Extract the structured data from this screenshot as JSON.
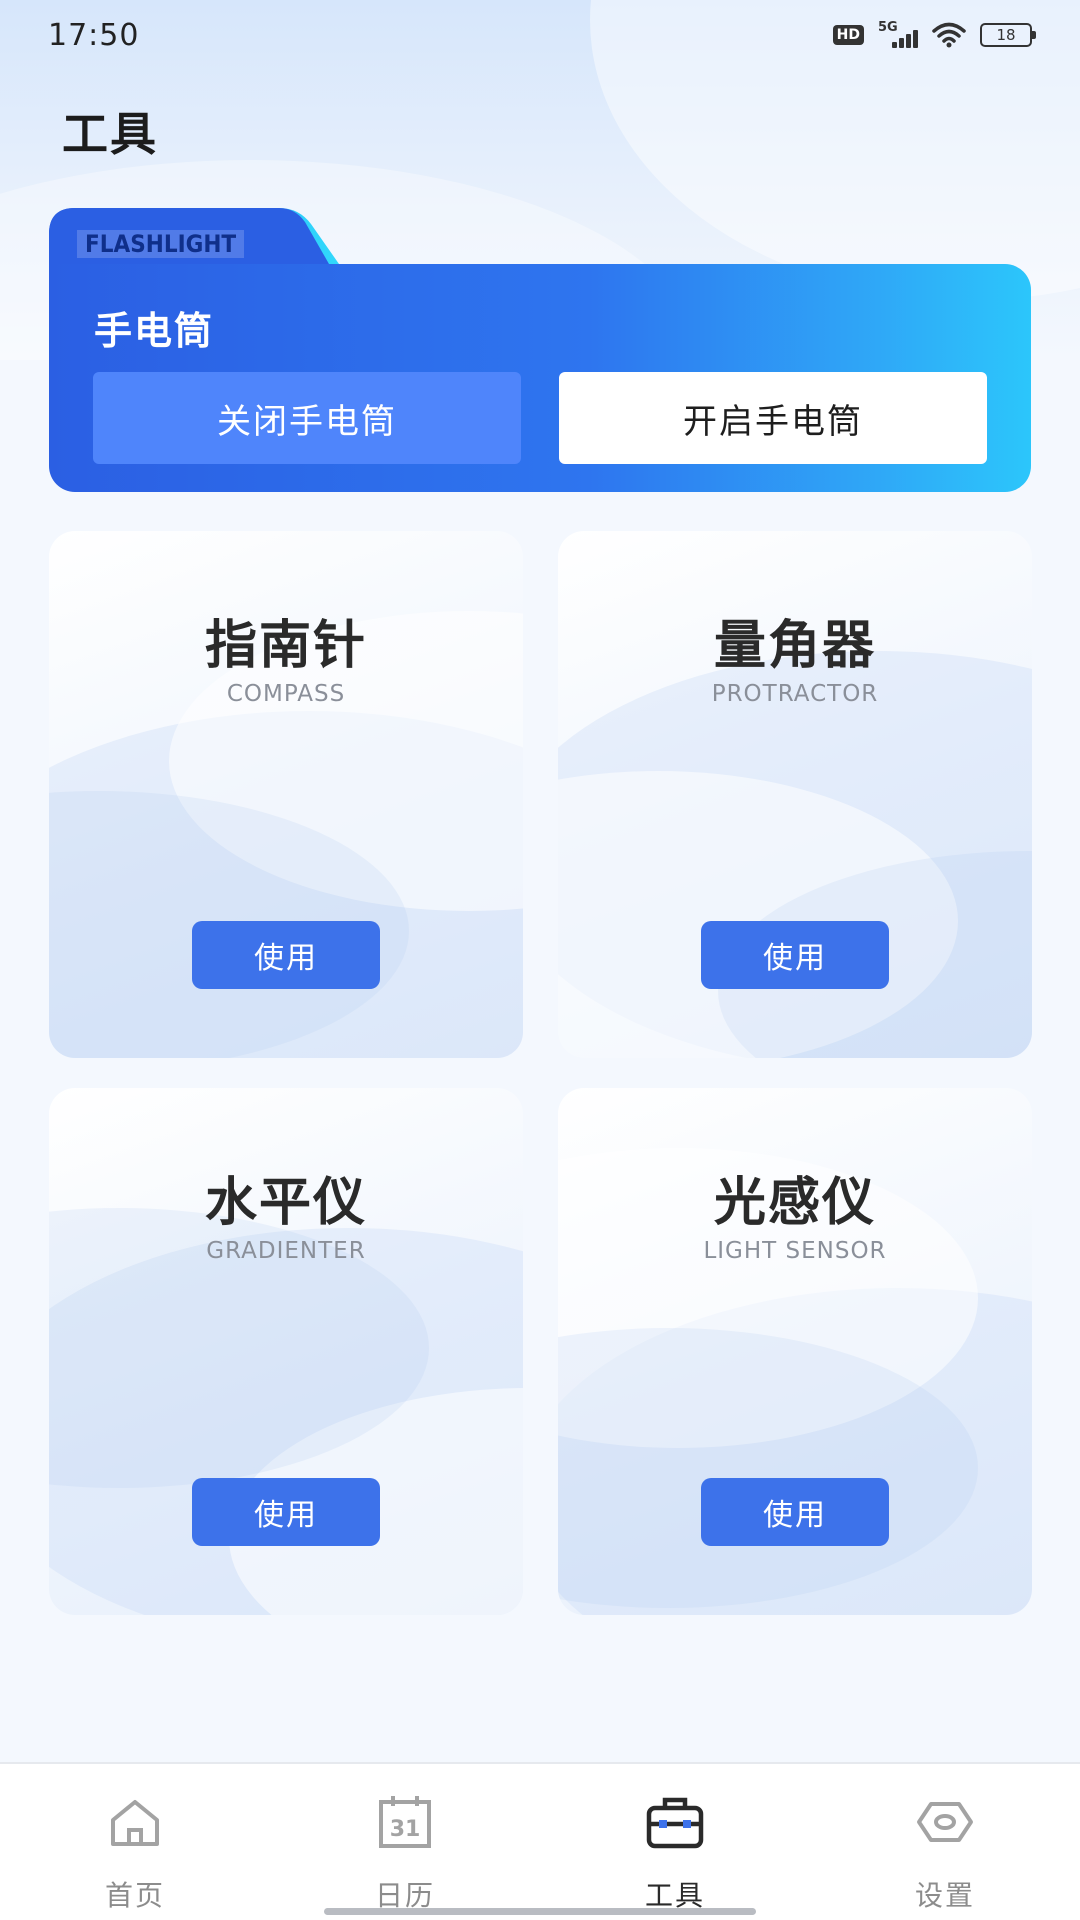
{
  "status_bar": {
    "time": "17:50",
    "hd_label": "HD",
    "network_label": "5G",
    "battery": "18"
  },
  "page": {
    "title": "工具"
  },
  "flashlight": {
    "tag": "FLASHLIGHT",
    "title": "手电筒",
    "off_label": "关闭手电筒",
    "on_label": "开启手电筒"
  },
  "tools": [
    {
      "name": "指南针",
      "sub": "COMPASS",
      "button": "使用"
    },
    {
      "name": "量角器",
      "sub": "PROTRACTOR",
      "button": "使用"
    },
    {
      "name": "水平仪",
      "sub": "GRADIENTER",
      "button": "使用"
    },
    {
      "name": "光感仪",
      "sub": "LIGHT SENSOR",
      "button": "使用"
    }
  ],
  "nav": {
    "items": [
      {
        "label": "首页",
        "icon": "home-icon",
        "active": false
      },
      {
        "label": "日历",
        "icon": "calendar-icon",
        "active": false
      },
      {
        "label": "工具",
        "icon": "toolbox-icon",
        "active": true
      },
      {
        "label": "设置",
        "icon": "eye-icon",
        "active": false
      }
    ]
  },
  "colors": {
    "accent": "#3d72ea",
    "banner_start": "#2b5fe3",
    "banner_end": "#2cc6fb"
  }
}
